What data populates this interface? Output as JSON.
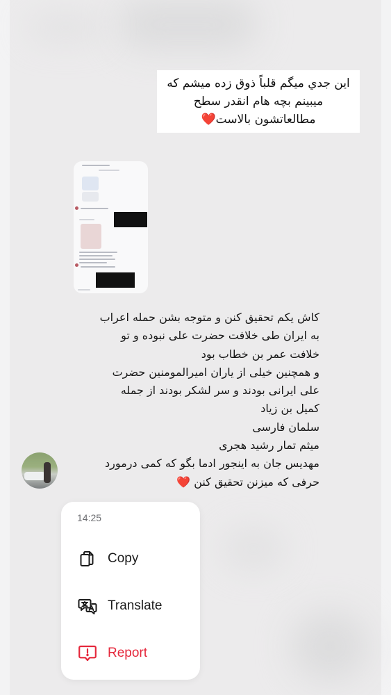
{
  "quote_card": {
    "lines": [
      "اين جدي ميگم قلباً ذوق زده میشم که",
      "میبینم بچه هام انقدر سطح",
      "مطالعاتشون بالاست❤️"
    ]
  },
  "message": {
    "lines": [
      "کاش یکم تحقیق کنن و متوجه بشن حمله اعراب",
      "به ایران طی خلافت حضرت علی نبوده  و  تو",
      "خلافت عمر بن خطاب بود",
      "و همچنین خیلی از یاران امیرالمومنین حضرت",
      "علی ایرانی بودند و سر لشکر بودند از جمله",
      "کمیل بن زیاد",
      "سلمان فارسی",
      "میثم تمار رشید هجری",
      "مهدیس جان به اینجور ادما بگو که کمی درمورد",
      "حرفی که میزنن تحقیق کنن ❤️"
    ]
  },
  "context_menu": {
    "time": "14:25",
    "items": [
      {
        "label": "Copy",
        "icon": "copy-icon"
      },
      {
        "label": "Translate",
        "icon": "translate-icon"
      },
      {
        "label": "Report",
        "icon": "report-icon",
        "color": "#e5283c"
      }
    ]
  }
}
